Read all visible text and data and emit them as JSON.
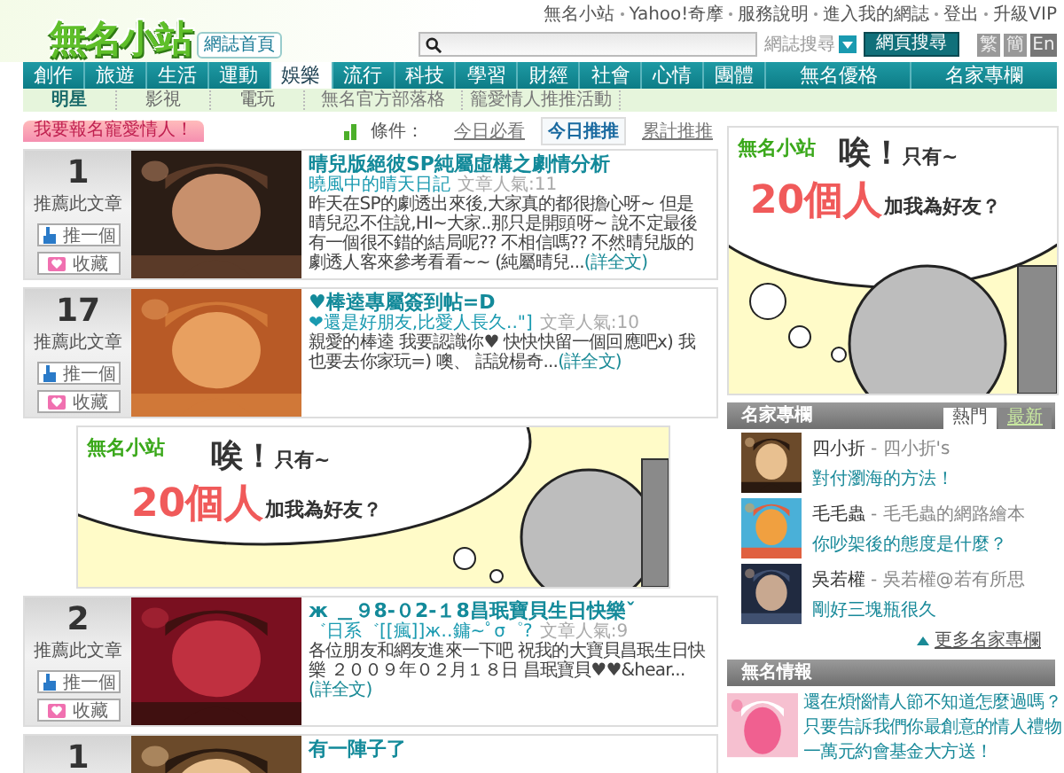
{
  "header": {
    "logo": "無名小站",
    "home_badge": "網誌首頁",
    "top_links": [
      "無名小站",
      "Yahoo!奇摩",
      "服務說明",
      "進入我的網誌",
      "登出",
      "升級VIP"
    ],
    "search": {
      "scope": "網誌搜尋",
      "button": "網頁搜尋"
    },
    "languages": [
      "繁",
      "簡",
      "En"
    ]
  },
  "nav": [
    {
      "label": "創作",
      "selected": false
    },
    {
      "label": "旅遊",
      "selected": false
    },
    {
      "label": "生活",
      "selected": false
    },
    {
      "label": "運動",
      "selected": false
    },
    {
      "label": "娛樂",
      "selected": true
    },
    {
      "label": "流行",
      "selected": false
    },
    {
      "label": "科技",
      "selected": false
    },
    {
      "label": "學習",
      "selected": false
    },
    {
      "label": "財經",
      "selected": false
    },
    {
      "label": "社會",
      "selected": false
    },
    {
      "label": "心情",
      "selected": false
    },
    {
      "label": "團體",
      "selected": false
    },
    {
      "label": "無名優格",
      "selected": false
    },
    {
      "label": "名家專欄",
      "selected": false
    }
  ],
  "subnav": [
    {
      "label": "明星",
      "kind": "category",
      "selected": true
    },
    {
      "label": "影視",
      "kind": "category",
      "selected": false
    },
    {
      "label": "電玩",
      "kind": "category",
      "selected": false
    },
    {
      "label": "無名官方部落格",
      "kind": "link",
      "selected": false
    },
    {
      "label": "籠愛情人推推活動",
      "kind": "link",
      "selected": false
    }
  ],
  "promo_tab": "我要報名寵愛情人！",
  "sort": {
    "label": "條件：",
    "options": [
      {
        "label": "今日必看",
        "selected": false
      },
      {
        "label": "今日推推",
        "selected": true
      },
      {
        "label": "累計推推",
        "selected": false
      }
    ]
  },
  "feed": [
    {
      "kind": "article",
      "count": "1",
      "count_label": "推薦此文章",
      "push": "推一個",
      "save": "收藏",
      "title": "晴兒版絕彼SP純屬虛構之劇情分析",
      "author": "曉風中的晴天日記",
      "popularity": "文章人氣:11",
      "excerpt": "昨天在SP的劇透出來後,大家真的都很擔心呀~ 但是晴兒忍不住說,HI~大家..那只是開頭呀~ 說不定最後有一個很不錯的結局呢?? 不相信嗎?? 不然晴兒版的劇透人客來參考看看~~ (純屬晴兒...",
      "more": "(詳全文)"
    },
    {
      "kind": "article",
      "count": "17",
      "count_label": "推薦此文章",
      "push": "推一個",
      "save": "收藏",
      "title": "♥棒逵專屬簽到帖=D",
      "author": "❤還是好朋友,比愛人長久..\"]",
      "popularity": "文章人氣:10",
      "excerpt": "親愛的棒逵 我要認識你♥ 快快快留一個回應吧x) 我也要去你家玩=) 噢、 話說楊奇...",
      "more": "(詳全文)"
    },
    {
      "kind": "banner",
      "logo": "無名小站",
      "exclaim": "唉！",
      "only": "只有~",
      "count": "20個人",
      "question": "加我為好友？"
    },
    {
      "kind": "article",
      "count": "2",
      "count_label": "推薦此文章",
      "push": "推一個",
      "save": "收藏",
      "title": "ж ＿９8-０2-１8昌珉寶貝生日快樂ˇ",
      "author": "゛日系゛[[瘋]]ж‥鏞~ﾟσ゜?",
      "popularity": "文章人氣:9",
      "excerpt": "各位朋友和網友進來一下吧 祝我的大寶貝昌珉生日快樂 ２００９年０２月１８日 昌珉寶貝♥♥&hear...",
      "more": "(詳全文)"
    },
    {
      "kind": "article",
      "count": "1",
      "title": "有一陣子了"
    }
  ],
  "side_banner": {
    "logo": "無名小站",
    "exclaim": "唉！",
    "only": "只有~",
    "count": "20個人",
    "question": "加我為好友？"
  },
  "columnists": {
    "title": "名家專欄",
    "tabs": [
      {
        "label": "熱門",
        "selected": true
      },
      {
        "label": "最新",
        "selected": false
      }
    ],
    "items": [
      {
        "name": "四小折",
        "blog": "- 四小折's",
        "post": "對付瀏海的方法！"
      },
      {
        "name": "毛毛蟲",
        "blog": "- 毛毛蟲的網路繪本",
        "post": "你吵架後的態度是什麼？"
      },
      {
        "name": "吳若權",
        "blog": "- 吳若權@若有所思",
        "post": "剛好三塊瓶很久"
      }
    ],
    "more": "更多名家專欄"
  },
  "news": {
    "title": "無名情報",
    "lines": [
      "還在煩惱情人節不知道怎麼過嗎？",
      "只要告訴我們你最創意的情人禮物",
      "一萬元約會基金大方送！"
    ]
  }
}
